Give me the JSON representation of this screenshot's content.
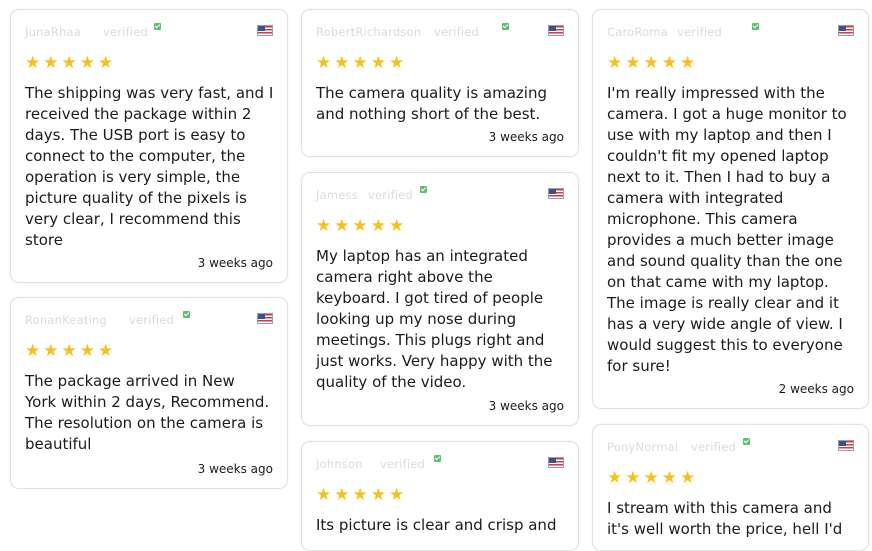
{
  "reviews": [
    {
      "name": "JunaRhaa",
      "verified": "verified",
      "rating": 5,
      "text": "The shipping was very fast, and I\nreceived the package within 2\ndays. The USB port is easy to\nconnect to the computer, the\noperation is very simple, the\npicture quality of the pixels is\nvery clear, I recommend this\nstore",
      "age": "3 weeks ago"
    },
    {
      "name": "RobertRichardson",
      "verified": "verified",
      "rating": 5,
      "text": "The camera quality is amazing\nand nothing short of the best.",
      "age": "3 weeks ago"
    },
    {
      "name": "CaroRoma",
      "verified": "verified",
      "rating": 5,
      "text": "I'm really impressed with the\ncamera. I got a huge monitor to\nuse with my laptop and then I\ncouldn't fit my opened laptop\nnext to it. Then I had to buy a\ncamera with integrated\nmicrophone. This camera\nprovides a much better image\nand sound quality than the one\non that came with my laptop.\nThe image is really clear and it\nhas a very wide angle of view. I\nwould suggest this to everyone\nfor sure!",
      "age": "2 weeks ago"
    },
    {
      "name": "Jamess",
      "verified": "verified",
      "rating": 5,
      "text": "My laptop has an integrated\ncamera right above the\nkeyboard. I got tired of people\nlooking up my nose during\nmeetings. This plugs right and\njust works. Very happy with the\nquality of the video.",
      "age": "3 weeks ago"
    },
    {
      "name": "RonanKeating",
      "verified": "verified",
      "rating": 5,
      "text": "The package arrived in New\nYork within 2 days, Recommend.\nThe resolution on the camera is\nbeautiful",
      "age": "3 weeks ago"
    },
    {
      "name": "Johnson",
      "verified": "verified",
      "rating": 5,
      "text": "Its picture is clear and crisp and",
      "age": ""
    },
    {
      "name": "PonyNormal",
      "verified": "verified",
      "rating": 5,
      "text": "I stream with this camera and\nit's well worth the price, hell I'd",
      "age": ""
    }
  ],
  "star_glyph": "★",
  "colors": {
    "star": "#f7c01f",
    "verified_check": "#5dc16a",
    "border": "#e2e2e2"
  },
  "icons": {
    "country": "us-flag-icon",
    "verified": "verified-check-icon",
    "rating": "star-icon"
  }
}
